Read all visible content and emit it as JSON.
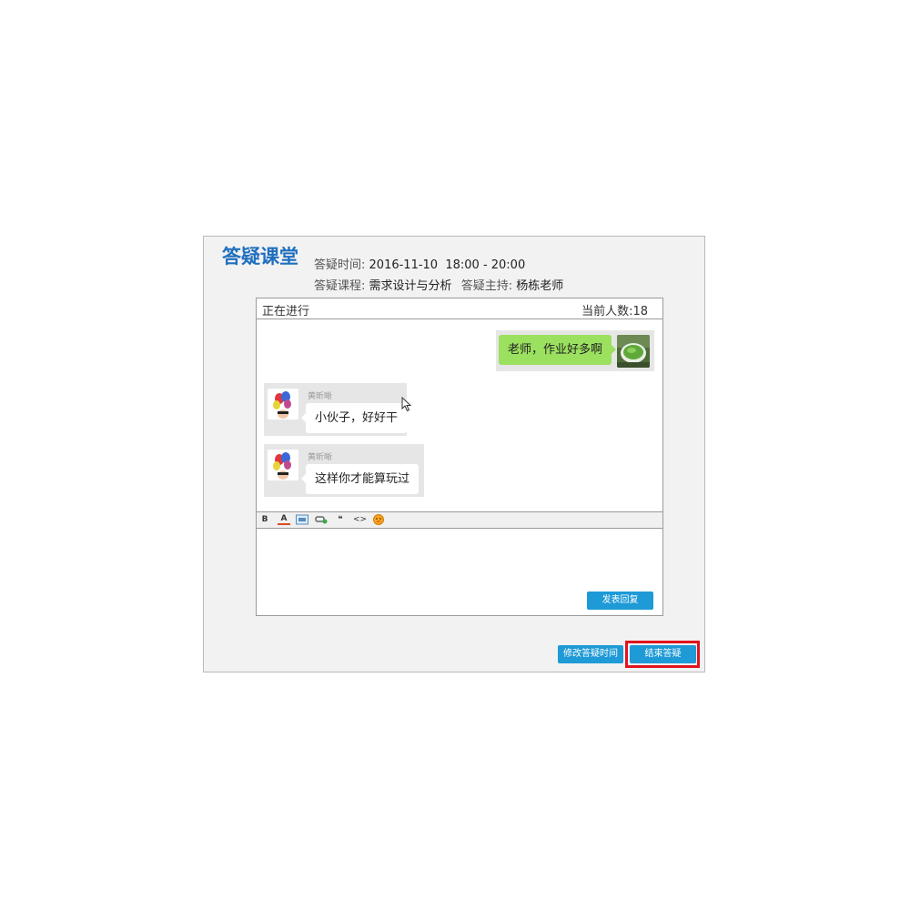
{
  "header": {
    "title": "答疑课堂",
    "time_label": "答疑时间:",
    "time_value": "2016-11-10  18:00 - 20:00",
    "course_label": "答疑课程:",
    "course_value": "需求设计与分析",
    "host_label": "答疑主持:",
    "host_value": "杨栋老师"
  },
  "chat": {
    "status": "正在进行",
    "online_count_label": "当前人数:18",
    "messages": [
      {
        "side": "right",
        "sender": "",
        "text": "老师，作业好多啊",
        "avatar": "green-tea-photo"
      },
      {
        "side": "left",
        "sender": "黄昕晰",
        "text": "小伙子，好好干",
        "avatar": "balloons-avatar"
      },
      {
        "side": "left",
        "sender": "黄昕晰",
        "text": "这样你才能算玩过",
        "avatar": "balloons-avatar"
      }
    ]
  },
  "toolbar": {
    "items": [
      "bold",
      "font-color",
      "image",
      "link",
      "quote",
      "code",
      "emoji"
    ],
    "bold_glyph": "B",
    "font_color_glyph": "A",
    "quote_glyph": "❝",
    "code_glyph": "<>"
  },
  "editor": {
    "submit_label": "发表回复"
  },
  "actions": {
    "modify_time_label": "修改答疑时间",
    "end_label": "结束答疑"
  },
  "colors": {
    "title": "#1f6fbf",
    "button": "#1e9ad6",
    "green_bubble": "#9be05f",
    "highlight": "#e0141e"
  }
}
